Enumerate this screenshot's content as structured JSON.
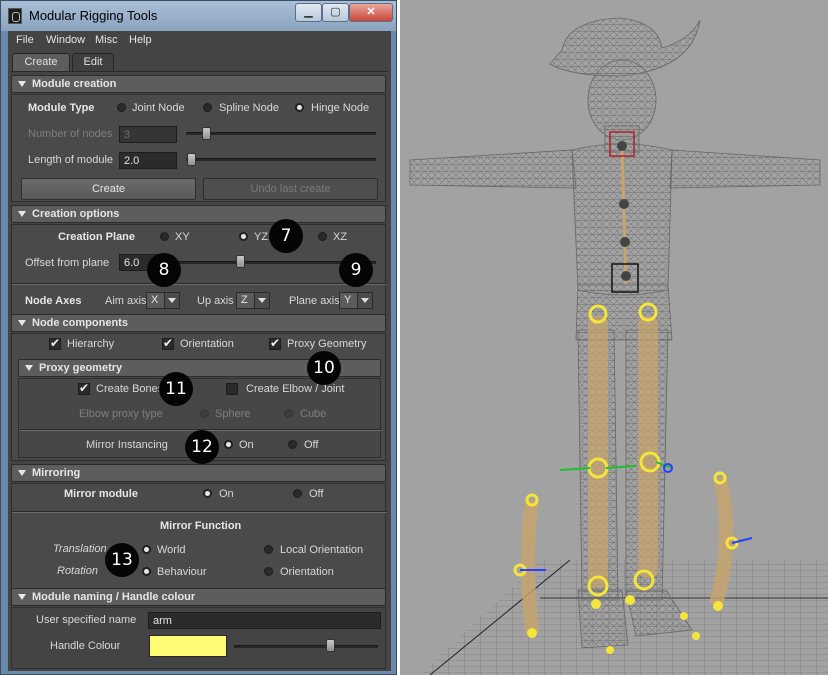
{
  "window": {
    "title": "Modular Rigging Tools"
  },
  "menu": [
    "File",
    "Window",
    "Misc",
    "Help"
  ],
  "tabs": {
    "create": "Create",
    "edit": "Edit"
  },
  "module_creation": {
    "header": "Module creation",
    "module_type_label": "Module Type",
    "types": [
      "Joint Node",
      "Spline Node",
      "Hinge Node"
    ],
    "selected_type": "Hinge Node",
    "nodes_label": "Number of nodes",
    "nodes_value": "3",
    "nodes_slider": 0.14,
    "length_label": "Length of module",
    "length_value": "2.0",
    "length_slider": 0.0,
    "create_button": "Create",
    "undo_button": "Undo last create"
  },
  "creation_options": {
    "header": "Creation options",
    "plane_label": "Creation Plane",
    "planes": [
      "XY",
      "YZ",
      "XZ"
    ],
    "selected_plane": "YZ",
    "offset_label": "Offset from plane",
    "offset_value": "6.0",
    "offset_slider": 0.5,
    "axes_label": "Node Axes",
    "aim_label": "Aim axis",
    "aim_value": "X",
    "up_label": "Up axis",
    "up_value": "Z",
    "plane_axis_label": "Plane axis",
    "plane_axis_value": "Y"
  },
  "node_components": {
    "header": "Node components",
    "items": [
      "Hierarchy",
      "Orientation",
      "Proxy Geometry"
    ]
  },
  "proxy_geometry": {
    "header": "Proxy geometry",
    "create_bones": "Create Bones",
    "create_elbow": "Create Elbow / Joint",
    "elbow_label": "Elbow proxy type",
    "elbow_sphere": "Sphere",
    "elbow_cube": "Cube",
    "mirror_label": "Mirror Instancing",
    "on": "On",
    "off": "Off"
  },
  "mirroring": {
    "header": "Mirroring",
    "mirror_module_label": "Mirror module",
    "on": "On",
    "off": "Off",
    "function_label": "Mirror Function",
    "translation_label": "Translation",
    "translation_world": "World",
    "translation_local": "Local Orientation",
    "rotation_label": "Rotation",
    "rotation_behaviour": "Behaviour",
    "rotation_orientation": "Orientation"
  },
  "naming": {
    "header": "Module naming / Handle colour",
    "name_label": "User specified name",
    "name_value": "arm",
    "colour_label": "Handle Colour",
    "colour_value": "#fffb73",
    "colour_slider": 0.8
  },
  "callouts": [
    "7",
    "8",
    "9",
    "10",
    "11",
    "12",
    "13"
  ],
  "colors": {
    "panel": "#444444",
    "viewport": "#a2a2a2",
    "handle": "#f5e53a",
    "bone": "#c9a56a"
  }
}
